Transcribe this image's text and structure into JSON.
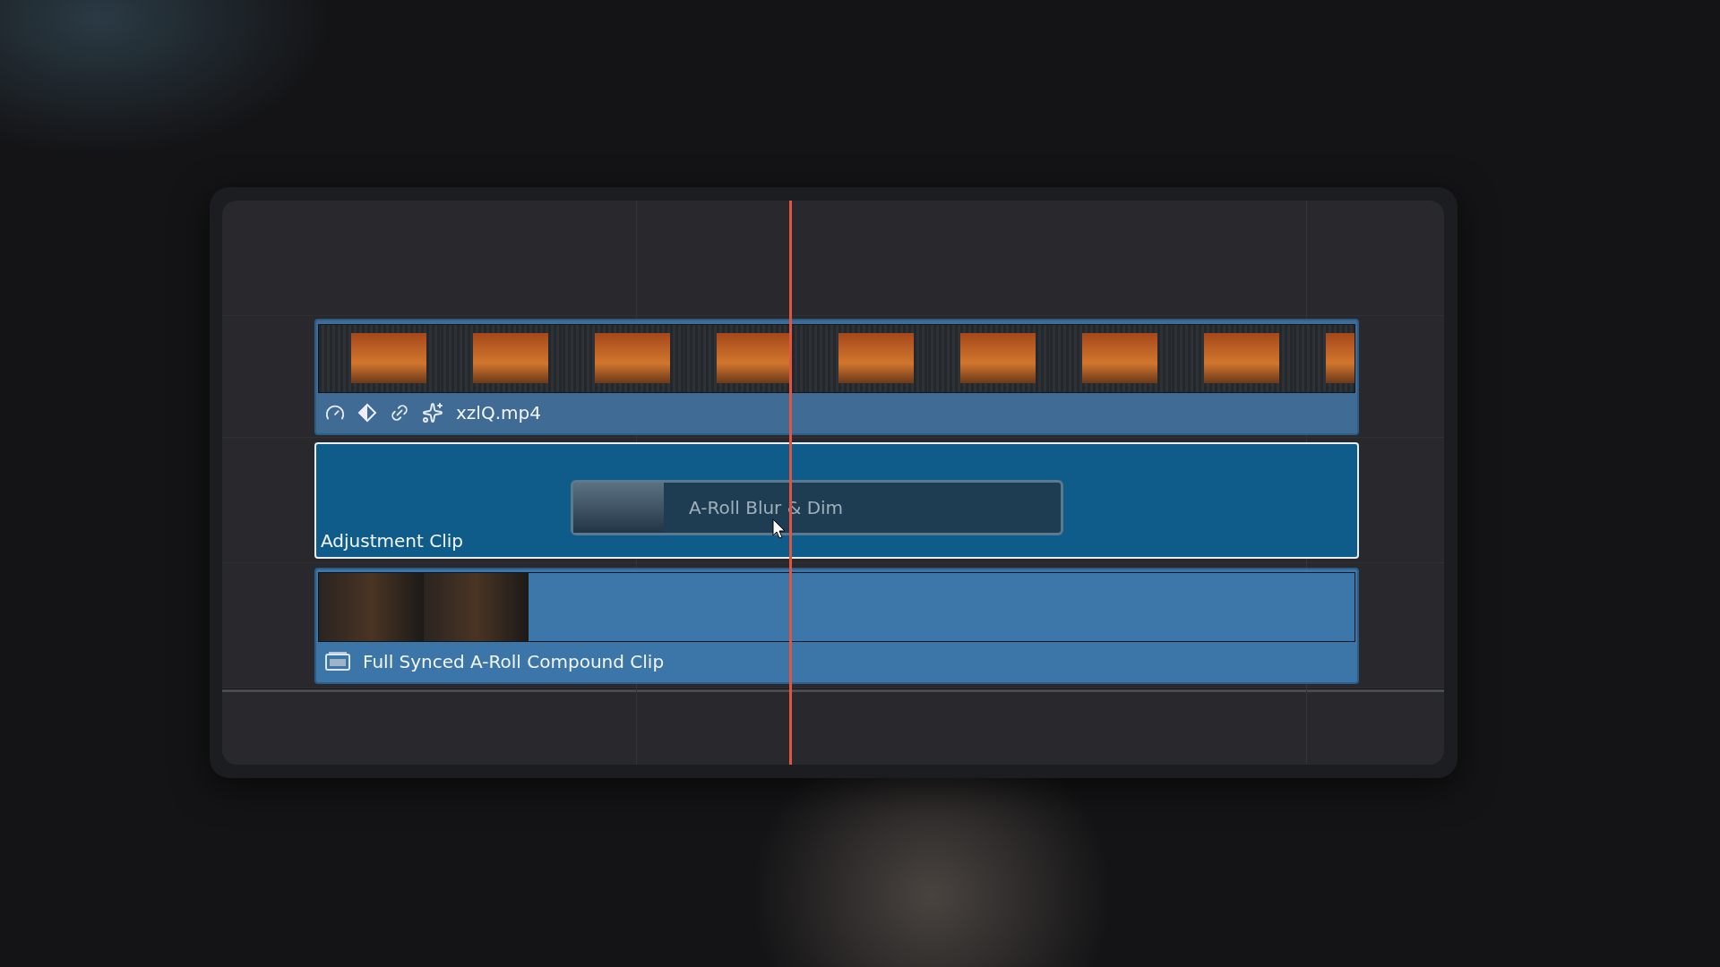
{
  "clips": [
    {
      "kind": "video",
      "name": "xzlQ.mp4"
    },
    {
      "kind": "adjustment",
      "name": "Adjustment Clip",
      "selected": true
    },
    {
      "kind": "compound",
      "name": "Full Synced A-Roll Compound Clip"
    }
  ],
  "drag_item": {
    "label": "A-Roll Blur & Dim"
  }
}
